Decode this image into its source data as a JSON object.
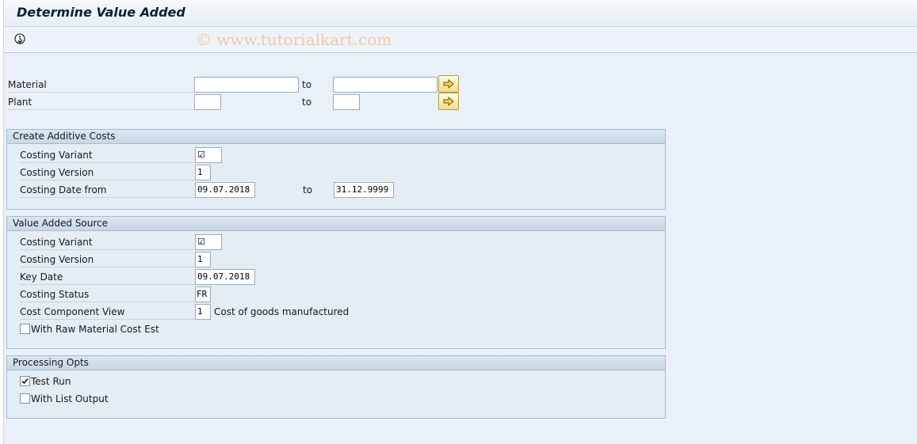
{
  "title": "Determine Value Added",
  "watermark": "© www.tutorialkart.com",
  "toolbar": {
    "execute_icon": "execute-icon"
  },
  "selection": {
    "material": {
      "label": "Material",
      "to_label": "to",
      "from_value": "",
      "to_value": ""
    },
    "plant": {
      "label": "Plant",
      "to_label": "to",
      "from_value": "",
      "to_value": ""
    }
  },
  "create_additive_costs": {
    "title": "Create Additive Costs",
    "costing_variant": {
      "label": "Costing Variant",
      "value": "☑"
    },
    "costing_version": {
      "label": "Costing Version",
      "value": "1"
    },
    "costing_date": {
      "label": "Costing Date from",
      "from_value": "09.07.2018",
      "to_label": "to",
      "to_value": "31.12.9999"
    }
  },
  "value_added_source": {
    "title": "Value Added Source",
    "costing_variant": {
      "label": "Costing Variant",
      "value": "☑"
    },
    "costing_version": {
      "label": "Costing Version",
      "value": "1"
    },
    "key_date": {
      "label": "Key Date",
      "value": "09.07.2018"
    },
    "costing_status": {
      "label": "Costing Status",
      "value": "FR"
    },
    "cost_component_view": {
      "label": "Cost Component View",
      "value": "1",
      "description": "Cost of goods manufactured"
    },
    "with_raw_material": {
      "label": "With Raw Material Cost Est",
      "checked": false
    }
  },
  "processing_opts": {
    "title": "Processing Opts",
    "test_run": {
      "label": "Test Run",
      "checked": true
    },
    "with_list_output": {
      "label": "With List Output",
      "checked": false
    }
  }
}
